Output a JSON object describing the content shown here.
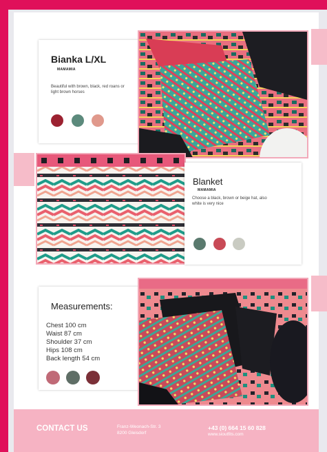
{
  "card1": {
    "title": "Bianka L/XL",
    "brand": "MAMAMIA",
    "description": "Beautiful with brown, black, red roans or light brown horses",
    "colors": [
      "#9c2231",
      "#5c8a7c",
      "#e0998c"
    ]
  },
  "card2": {
    "title": "Blanket",
    "brand": "MAMAMIA",
    "description": "Choose a black, brown or beige hat, also white is very nice",
    "colors": [
      "#5a7a6e",
      "#c84a56",
      "#c9cbc2"
    ]
  },
  "card3": {
    "title": "Measurements:",
    "lines": [
      "Chest 100 cm",
      "Waist 87 cm",
      "Shoulder 37 cm",
      "Hips 108 cm",
      "Back length 54 cm"
    ],
    "colors": [
      "#c06a77",
      "#5f6e66",
      "#7b3038"
    ]
  },
  "footer": {
    "contact_label": "CONTACT US",
    "address_line1": "Franz-Weonach-Str. 3",
    "address_line2": "8200 Gleisdorf",
    "phone": "+43 (0) 664 15 60 828",
    "website": "www.sioutfits.com"
  },
  "palette": {
    "frame": "#e0105a",
    "accent_pink": "#f6bcc9",
    "footer_pink": "#f6b3c3"
  },
  "images": {
    "photo1": "vest-on-red-jacket-photo",
    "photo2": "blanket-pattern-photo",
    "photo3": "vest-on-black-jacket-photo"
  }
}
